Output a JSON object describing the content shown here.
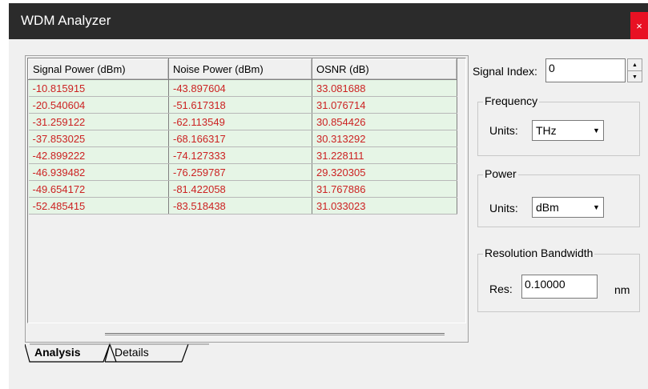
{
  "window": {
    "title": "WDM Analyzer",
    "close_label": "×"
  },
  "table": {
    "headers": [
      "Signal Power (dBm)",
      "Noise Power (dBm)",
      "OSNR (dB)"
    ],
    "rows": [
      [
        "-10.815915",
        "-43.897604",
        "33.081688"
      ],
      [
        "-20.540604",
        "-51.617318",
        "31.076714"
      ],
      [
        "-31.259122",
        "-62.113549",
        "30.854426"
      ],
      [
        "-37.853025",
        "-68.166317",
        "30.313292"
      ],
      [
        "-42.899222",
        "-74.127333",
        "31.228111"
      ],
      [
        "-46.939482",
        "-76.259787",
        "29.320305"
      ],
      [
        "-49.654172",
        "-81.422058",
        "31.767886"
      ],
      [
        "-52.485415",
        "-83.518438",
        "31.033023"
      ]
    ]
  },
  "tabs": [
    {
      "label": "Analysis",
      "active": true
    },
    {
      "label": "Details",
      "active": false
    }
  ],
  "signal_index": {
    "label": "Signal Index:",
    "value": "0"
  },
  "frequency": {
    "title": "Frequency",
    "units_label": "Units:",
    "units_value": "THz"
  },
  "power": {
    "title": "Power",
    "units_label": "Units:",
    "units_value": "dBm"
  },
  "resolution": {
    "title": "Resolution Bandwidth",
    "res_label": "Res:",
    "res_value": "0.10000",
    "unit": "nm"
  },
  "colors": {
    "cell_text": "#cc2222",
    "cell_bg": "#e6f5e6",
    "titlebar": "#2b2b2b",
    "close": "#e81123"
  }
}
